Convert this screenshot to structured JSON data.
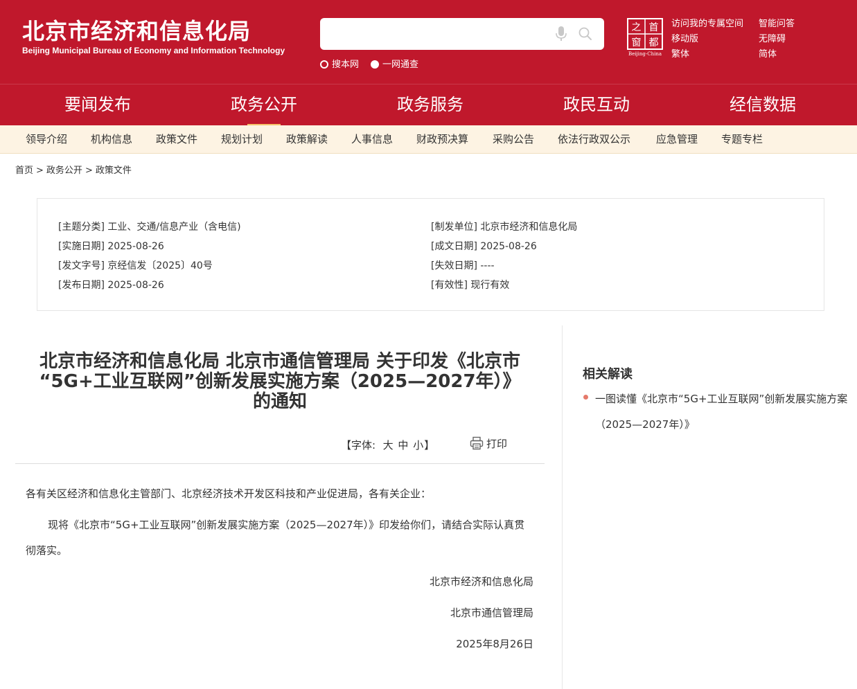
{
  "header": {
    "logo_cn": "北京市经济和信息化局",
    "logo_en": "Beijing Municipal Bureau of Economy and Information Technology",
    "search_placeholder": "",
    "search_scope": [
      "搜本网",
      "一网通查"
    ],
    "capital_logo": {
      "chars": [
        "之",
        "首",
        "窗",
        "都"
      ],
      "caption": "Beijing-China"
    },
    "links": [
      "访问我的专属空间",
      "智能问答",
      "移动版",
      "无障碍",
      "繁体",
      "简体"
    ]
  },
  "main_nav": {
    "items": [
      "要闻发布",
      "政务公开",
      "政务服务",
      "政民互动",
      "经信数据"
    ],
    "active": "政务公开"
  },
  "sub_nav": {
    "items": [
      "领导介绍",
      "机构信息",
      "政策文件",
      "规划计划",
      "政策解读",
      "人事信息",
      "财政预决算",
      "采购公告",
      "依法行政双公示",
      "应急管理",
      "专题专栏"
    ]
  },
  "breadcrumb": [
    "首页",
    "政务公开",
    "政策文件"
  ],
  "info": {
    "topic": "[主题分类] 工业、交通/信息产业（含电信)",
    "implement_date": "[实施日期] 2025-08-26",
    "doc_number": "[发文字号] 京经信发〔2025〕40号",
    "publish_date": "[发布日期] 2025-08-26",
    "issuer": "[制发单位] 北京市经济和信息化局",
    "written_date": "[成文日期] 2025-08-26",
    "expiry_date": "[失效日期] ----",
    "validity": "[有效性] 现行有效"
  },
  "article": {
    "title_lines": [
      "北京市经济和信息化局 北京市通信管理局 关于印发《北京市",
      "“5G+工业互联网”创新发展实施方案（2025—2027年）》",
      "的通知"
    ],
    "font_label": "【字体:",
    "font_large": "大",
    "font_medium": "中",
    "font_small": "小",
    "font_end": "】",
    "print_label": "打印",
    "greeting": "各有关区经济和信息化主管部门、北京经济技术开发区科技和产业促进局，各有关企业：",
    "body": "现将《北京市“5G+工业互联网”创新发展实施方案（2025—2027年）》印发给你们，请结合实际认真贯彻落实。",
    "signer1": "北京市经济和信息化局",
    "signer2": "北京市通信管理局",
    "date": "2025年8月26日"
  },
  "sidebar": {
    "title": "相关解读",
    "links": [
      "一图读懂《北京市“5G+工业互联网”创新发展实施方案（2025—2027年）》"
    ]
  },
  "colors": {
    "brand_red": "#c0182c",
    "subnav_bg": "#fdf3e3",
    "active_underline": "#f5c26b"
  }
}
